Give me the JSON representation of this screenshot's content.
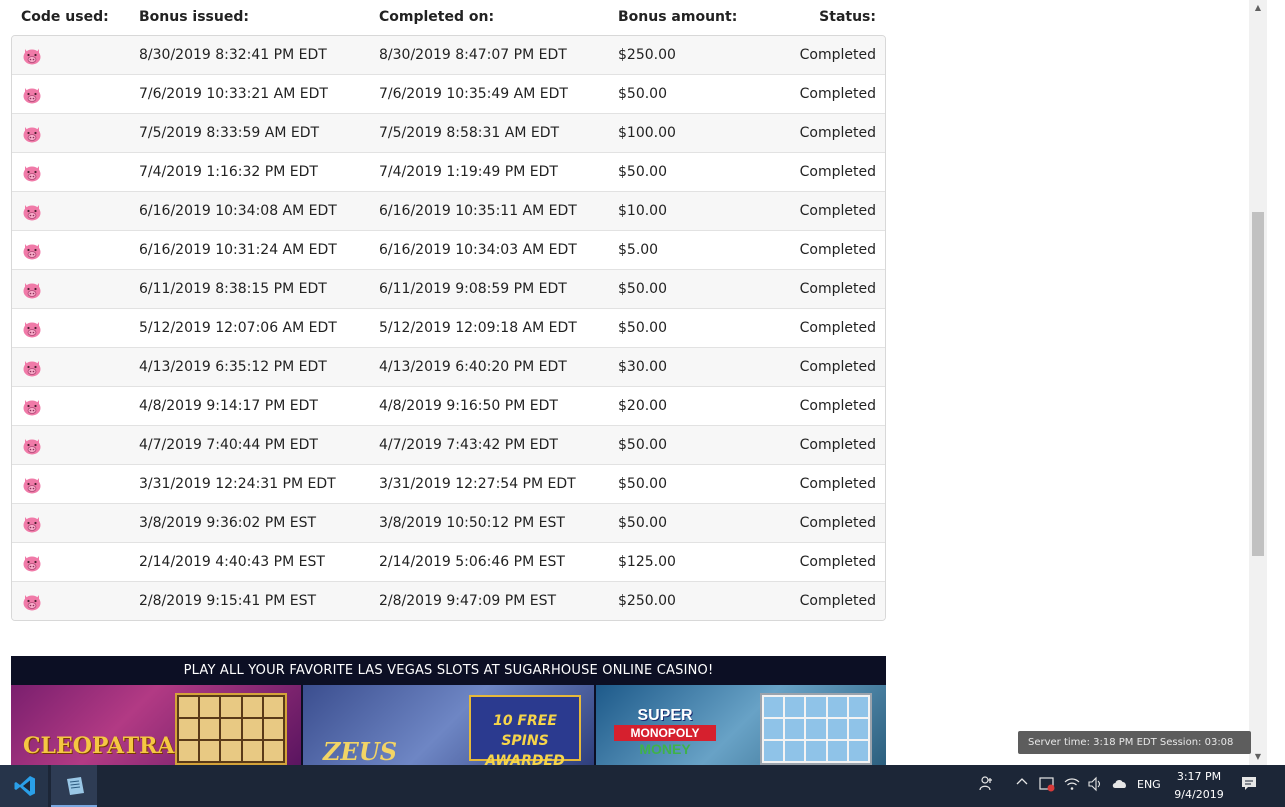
{
  "table": {
    "headers": {
      "code_used": "Code used:",
      "bonus_issued": "Bonus issued:",
      "completed_on": "Completed on:",
      "bonus_amount": "Bonus amount:",
      "status": "Status:"
    },
    "rows": [
      {
        "issued": "8/30/2019 8:32:41 PM EDT",
        "completed": "8/30/2019 8:47:07 PM EDT",
        "amount": "$250.00",
        "status": "Completed"
      },
      {
        "issued": "7/6/2019 10:33:21 AM EDT",
        "completed": "7/6/2019 10:35:49 AM EDT",
        "amount": "$50.00",
        "status": "Completed"
      },
      {
        "issued": "7/5/2019 8:33:59 AM EDT",
        "completed": "7/5/2019 8:58:31 AM EDT",
        "amount": "$100.00",
        "status": "Completed"
      },
      {
        "issued": "7/4/2019 1:16:32 PM EDT",
        "completed": "7/4/2019 1:19:49 PM EDT",
        "amount": "$50.00",
        "status": "Completed"
      },
      {
        "issued": "6/16/2019 10:34:08 AM EDT",
        "completed": "6/16/2019 10:35:11 AM EDT",
        "amount": "$10.00",
        "status": "Completed"
      },
      {
        "issued": "6/16/2019 10:31:24 AM EDT",
        "completed": "6/16/2019 10:34:03 AM EDT",
        "amount": "$5.00",
        "status": "Completed"
      },
      {
        "issued": "6/11/2019 8:38:15 PM EDT",
        "completed": "6/11/2019 9:08:59 PM EDT",
        "amount": "$50.00",
        "status": "Completed"
      },
      {
        "issued": "5/12/2019 12:07:06 AM EDT",
        "completed": "5/12/2019 12:09:18 AM EDT",
        "amount": "$50.00",
        "status": "Completed"
      },
      {
        "issued": "4/13/2019 6:35:12 PM EDT",
        "completed": "4/13/2019 6:40:20 PM EDT",
        "amount": "$30.00",
        "status": "Completed"
      },
      {
        "issued": "4/8/2019 9:14:17 PM EDT",
        "completed": "4/8/2019 9:16:50 PM EDT",
        "amount": "$20.00",
        "status": "Completed"
      },
      {
        "issued": "4/7/2019 7:40:44 PM EDT",
        "completed": "4/7/2019 7:43:42 PM EDT",
        "amount": "$50.00",
        "status": "Completed"
      },
      {
        "issued": "3/31/2019 12:24:31 PM EDT",
        "completed": "3/31/2019 12:27:54 PM EDT",
        "amount": "$50.00",
        "status": "Completed"
      },
      {
        "issued": "3/8/2019 9:36:02 PM EST",
        "completed": "3/8/2019 10:50:12 PM EST",
        "amount": "$50.00",
        "status": "Completed"
      },
      {
        "issued": "2/14/2019 4:40:43 PM EST",
        "completed": "2/14/2019 5:06:46 PM EST",
        "amount": "$125.00",
        "status": "Completed"
      },
      {
        "issued": "2/8/2019 9:15:41 PM EST",
        "completed": "2/8/2019 9:47:09 PM EST",
        "amount": "$250.00",
        "status": "Completed"
      }
    ],
    "code_icon": "pig-icon"
  },
  "banner": {
    "headline": "PLAY ALL YOUR FAVORITE LAS VEGAS SLOTS AT SUGARHOUSE ONLINE CASINO!",
    "games": [
      {
        "logo": "CLEOPATRA"
      },
      {
        "logo": "ZEUS",
        "badge": "10 FREE SPINS AWARDED"
      },
      {
        "logo_line1": "SUPER",
        "logo_line2": "MONOPOLY",
        "logo_line3": "MONEY"
      }
    ]
  },
  "tooltip": {
    "text": "Server time: 3:18 PM  EDT   Session: 03:08"
  },
  "taskbar": {
    "apps": [
      "vscode-icon",
      "app-icon"
    ],
    "tray": {
      "language": "ENG",
      "time": "3:17 PM",
      "date": "9/4/2019"
    }
  },
  "colors": {
    "row_odd": "#f7f7f7",
    "row_even": "#ffffff",
    "taskbar": "#1c2637",
    "banner_bg": "#0c0f24",
    "pig": "#f07aa8"
  }
}
